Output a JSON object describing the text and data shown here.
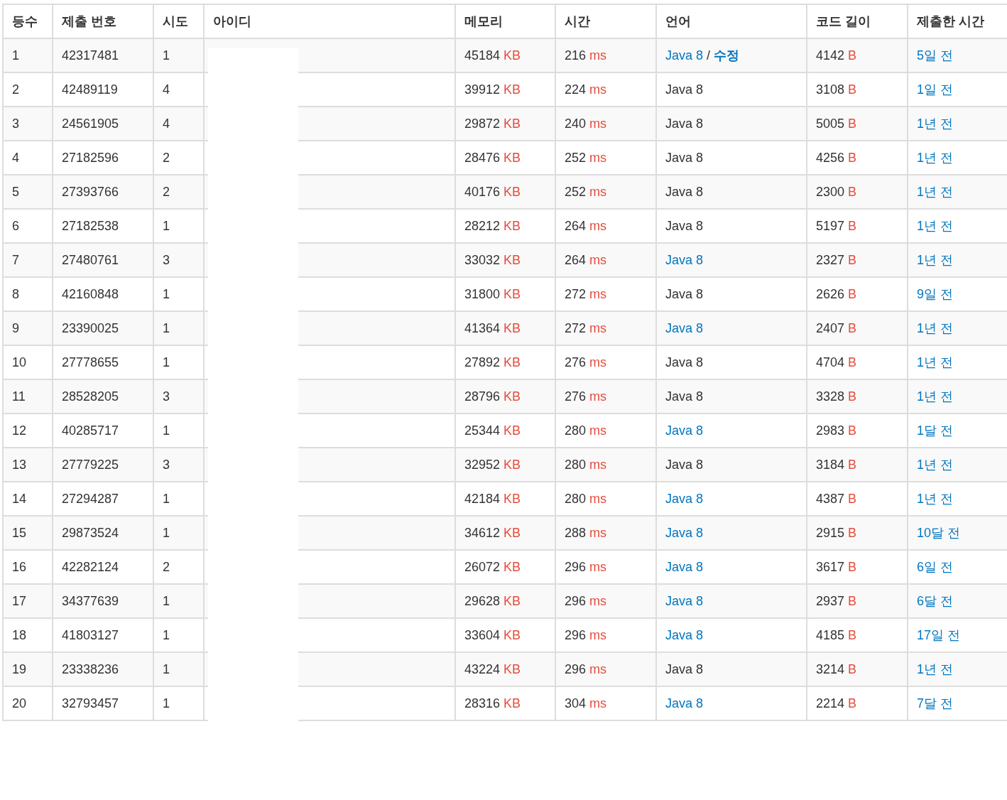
{
  "table": {
    "columns": [
      "등수",
      "제출 번호",
      "시도",
      "아이디",
      "메모리",
      "시간",
      "언어",
      "코드 길이",
      "제출한 시간"
    ],
    "rows": [
      {
        "rank": "1",
        "submission": "42317481",
        "tries": "1",
        "memory": {
          "value": "45184",
          "unit": "KB"
        },
        "time": {
          "value": "216",
          "unit": "ms"
        },
        "language": {
          "label": "Java 8",
          "link": true,
          "separator": "/",
          "edit": "수정"
        },
        "code_length": {
          "value": "4142",
          "unit": "B"
        },
        "submitted": "5일 전"
      },
      {
        "rank": "2",
        "submission": "42489119",
        "tries": "4",
        "memory": {
          "value": "39912",
          "unit": "KB"
        },
        "time": {
          "value": "224",
          "unit": "ms"
        },
        "language": {
          "label": "Java 8",
          "link": false
        },
        "code_length": {
          "value": "3108",
          "unit": "B"
        },
        "submitted": "1일 전"
      },
      {
        "rank": "3",
        "submission": "24561905",
        "tries": "4",
        "memory": {
          "value": "29872",
          "unit": "KB"
        },
        "time": {
          "value": "240",
          "unit": "ms"
        },
        "language": {
          "label": "Java 8",
          "link": false
        },
        "code_length": {
          "value": "5005",
          "unit": "B"
        },
        "submitted": "1년 전"
      },
      {
        "rank": "4",
        "submission": "27182596",
        "tries": "2",
        "memory": {
          "value": "28476",
          "unit": "KB"
        },
        "time": {
          "value": "252",
          "unit": "ms"
        },
        "language": {
          "label": "Java 8",
          "link": false
        },
        "code_length": {
          "value": "4256",
          "unit": "B"
        },
        "submitted": "1년 전"
      },
      {
        "rank": "5",
        "submission": "27393766",
        "tries": "2",
        "memory": {
          "value": "40176",
          "unit": "KB"
        },
        "time": {
          "value": "252",
          "unit": "ms"
        },
        "language": {
          "label": "Java 8",
          "link": false
        },
        "code_length": {
          "value": "2300",
          "unit": "B"
        },
        "submitted": "1년 전"
      },
      {
        "rank": "6",
        "submission": "27182538",
        "tries": "1",
        "memory": {
          "value": "28212",
          "unit": "KB"
        },
        "time": {
          "value": "264",
          "unit": "ms"
        },
        "language": {
          "label": "Java 8",
          "link": false
        },
        "code_length": {
          "value": "5197",
          "unit": "B"
        },
        "submitted": "1년 전"
      },
      {
        "rank": "7",
        "submission": "27480761",
        "tries": "3",
        "memory": {
          "value": "33032",
          "unit": "KB"
        },
        "time": {
          "value": "264",
          "unit": "ms"
        },
        "language": {
          "label": "Java 8",
          "link": true
        },
        "code_length": {
          "value": "2327",
          "unit": "B"
        },
        "submitted": "1년 전"
      },
      {
        "rank": "8",
        "submission": "42160848",
        "tries": "1",
        "memory": {
          "value": "31800",
          "unit": "KB"
        },
        "time": {
          "value": "272",
          "unit": "ms"
        },
        "language": {
          "label": "Java 8",
          "link": false
        },
        "code_length": {
          "value": "2626",
          "unit": "B"
        },
        "submitted": "9일 전"
      },
      {
        "rank": "9",
        "submission": "23390025",
        "tries": "1",
        "memory": {
          "value": "41364",
          "unit": "KB"
        },
        "time": {
          "value": "272",
          "unit": "ms"
        },
        "language": {
          "label": "Java 8",
          "link": true
        },
        "code_length": {
          "value": "2407",
          "unit": "B"
        },
        "submitted": "1년 전"
      },
      {
        "rank": "10",
        "submission": "27778655",
        "tries": "1",
        "memory": {
          "value": "27892",
          "unit": "KB"
        },
        "time": {
          "value": "276",
          "unit": "ms"
        },
        "language": {
          "label": "Java 8",
          "link": false
        },
        "code_length": {
          "value": "4704",
          "unit": "B"
        },
        "submitted": "1년 전"
      },
      {
        "rank": "11",
        "submission": "28528205",
        "tries": "3",
        "memory": {
          "value": "28796",
          "unit": "KB"
        },
        "time": {
          "value": "276",
          "unit": "ms"
        },
        "language": {
          "label": "Java 8",
          "link": false
        },
        "code_length": {
          "value": "3328",
          "unit": "B"
        },
        "submitted": "1년 전"
      },
      {
        "rank": "12",
        "submission": "40285717",
        "tries": "1",
        "memory": {
          "value": "25344",
          "unit": "KB"
        },
        "time": {
          "value": "280",
          "unit": "ms"
        },
        "language": {
          "label": "Java 8",
          "link": true
        },
        "code_length": {
          "value": "2983",
          "unit": "B"
        },
        "submitted": "1달 전"
      },
      {
        "rank": "13",
        "submission": "27779225",
        "tries": "3",
        "memory": {
          "value": "32952",
          "unit": "KB"
        },
        "time": {
          "value": "280",
          "unit": "ms"
        },
        "language": {
          "label": "Java 8",
          "link": false
        },
        "code_length": {
          "value": "3184",
          "unit": "B"
        },
        "submitted": "1년 전"
      },
      {
        "rank": "14",
        "submission": "27294287",
        "tries": "1",
        "memory": {
          "value": "42184",
          "unit": "KB"
        },
        "time": {
          "value": "280",
          "unit": "ms"
        },
        "language": {
          "label": "Java 8",
          "link": true
        },
        "code_length": {
          "value": "4387",
          "unit": "B"
        },
        "submitted": "1년 전"
      },
      {
        "rank": "15",
        "submission": "29873524",
        "tries": "1",
        "memory": {
          "value": "34612",
          "unit": "KB"
        },
        "time": {
          "value": "288",
          "unit": "ms"
        },
        "language": {
          "label": "Java 8",
          "link": true
        },
        "code_length": {
          "value": "2915",
          "unit": "B"
        },
        "submitted": "10달 전"
      },
      {
        "rank": "16",
        "submission": "42282124",
        "tries": "2",
        "memory": {
          "value": "26072",
          "unit": "KB"
        },
        "time": {
          "value": "296",
          "unit": "ms"
        },
        "language": {
          "label": "Java 8",
          "link": true
        },
        "code_length": {
          "value": "3617",
          "unit": "B"
        },
        "submitted": "6일 전"
      },
      {
        "rank": "17",
        "submission": "34377639",
        "tries": "1",
        "memory": {
          "value": "29628",
          "unit": "KB"
        },
        "time": {
          "value": "296",
          "unit": "ms"
        },
        "language": {
          "label": "Java 8",
          "link": true
        },
        "code_length": {
          "value": "2937",
          "unit": "B"
        },
        "submitted": "6달 전"
      },
      {
        "rank": "18",
        "submission": "41803127",
        "tries": "1",
        "memory": {
          "value": "33604",
          "unit": "KB"
        },
        "time": {
          "value": "296",
          "unit": "ms"
        },
        "language": {
          "label": "Java 8",
          "link": true
        },
        "code_length": {
          "value": "4185",
          "unit": "B"
        },
        "submitted": "17일 전"
      },
      {
        "rank": "19",
        "submission": "23338236",
        "tries": "1",
        "memory": {
          "value": "43224",
          "unit": "KB"
        },
        "time": {
          "value": "296",
          "unit": "ms"
        },
        "language": {
          "label": "Java 8",
          "link": false
        },
        "code_length": {
          "value": "3214",
          "unit": "B"
        },
        "submitted": "1년 전"
      },
      {
        "rank": "20",
        "submission": "32793457",
        "tries": "1",
        "memory": {
          "value": "28316",
          "unit": "KB"
        },
        "time": {
          "value": "304",
          "unit": "ms"
        },
        "language": {
          "label": "Java 8",
          "link": true
        },
        "code_length": {
          "value": "2214",
          "unit": "B"
        },
        "submitted": "7달 전"
      }
    ]
  }
}
